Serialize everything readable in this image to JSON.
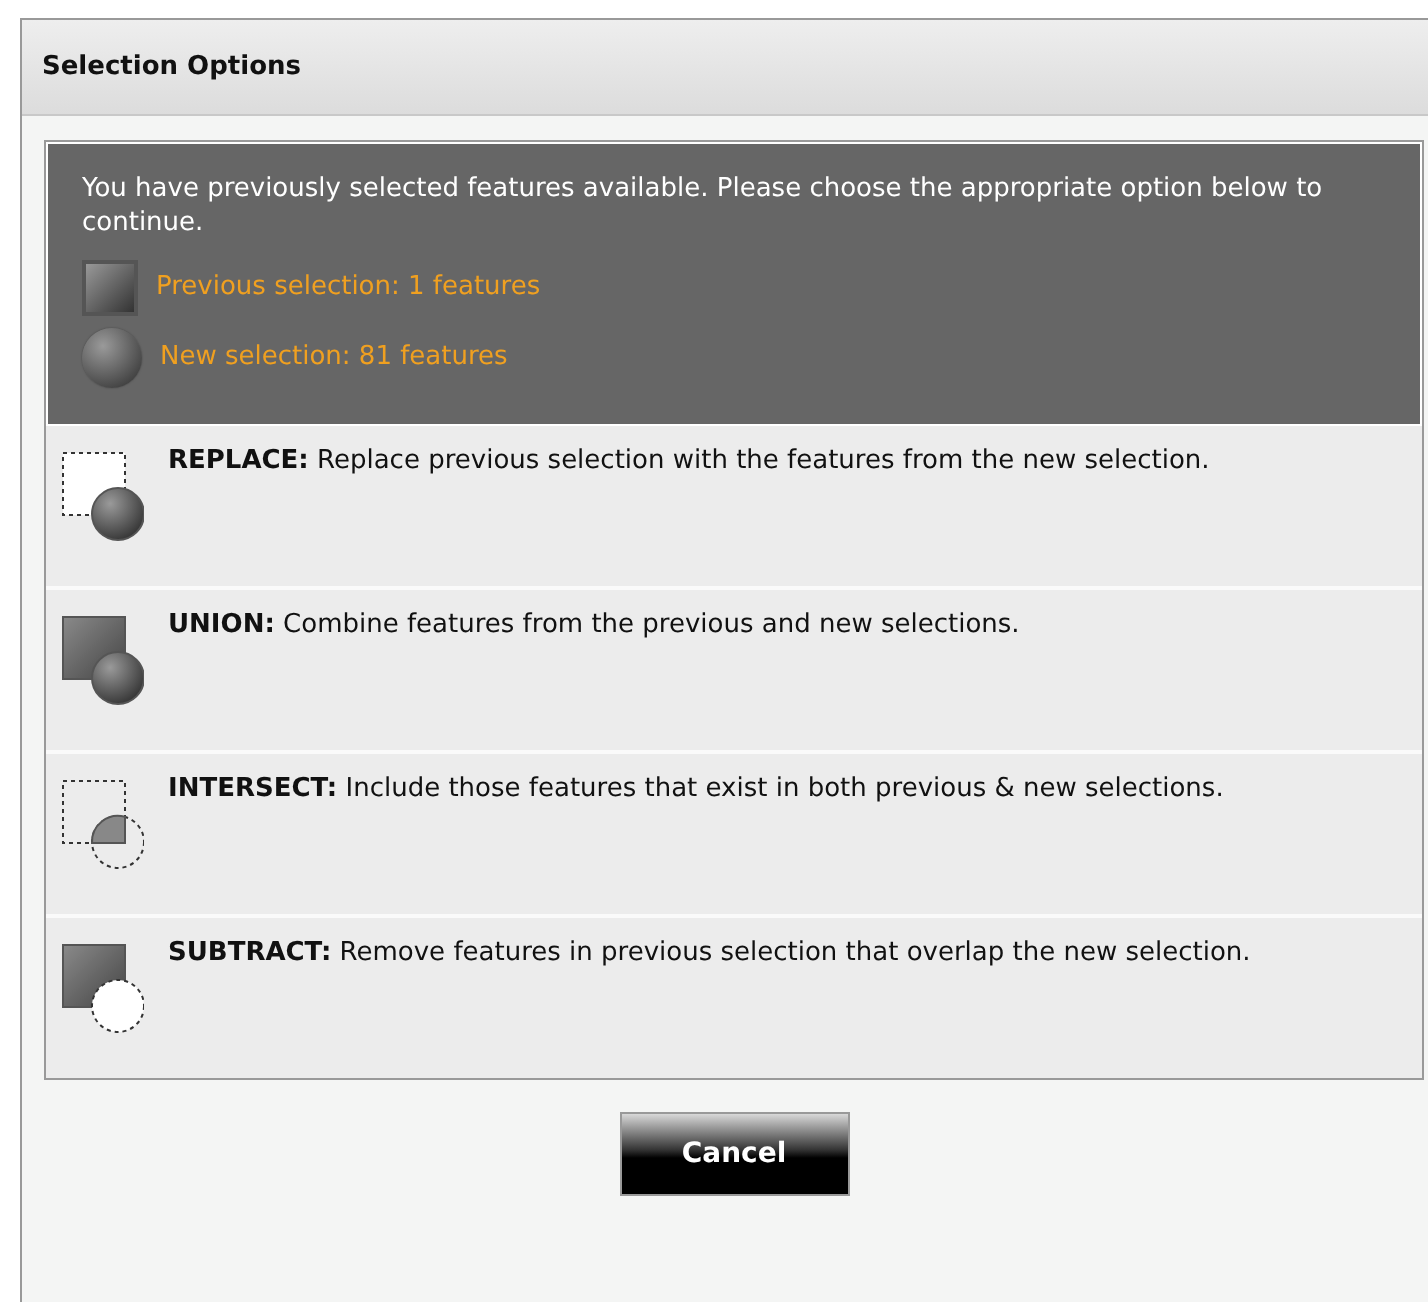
{
  "dialog": {
    "title": "Selection Options"
  },
  "intro": "You have previously selected features available. Please choose the appropriate option below to continue.",
  "selections": [
    {
      "kind": "square",
      "label": "Previous selection: 1 features"
    },
    {
      "kind": "circle",
      "label": "New selection: 81 features"
    }
  ],
  "options": [
    {
      "kind": "replace",
      "text": "**REPLACE:** Replace previous selection with the features from the new selection."
    },
    {
      "kind": "union",
      "text": "**UNION:** Combine features from the previous and new selections."
    },
    {
      "kind": "intersect",
      "text": "**INTERSECT:** Include those features that exist in both previous & new selections."
    },
    {
      "kind": "subtract",
      "text": "**SUBTRACT:** Remove features in previous selection that overlap the new selection."
    }
  ],
  "buttons": [
    "Cancel"
  ]
}
